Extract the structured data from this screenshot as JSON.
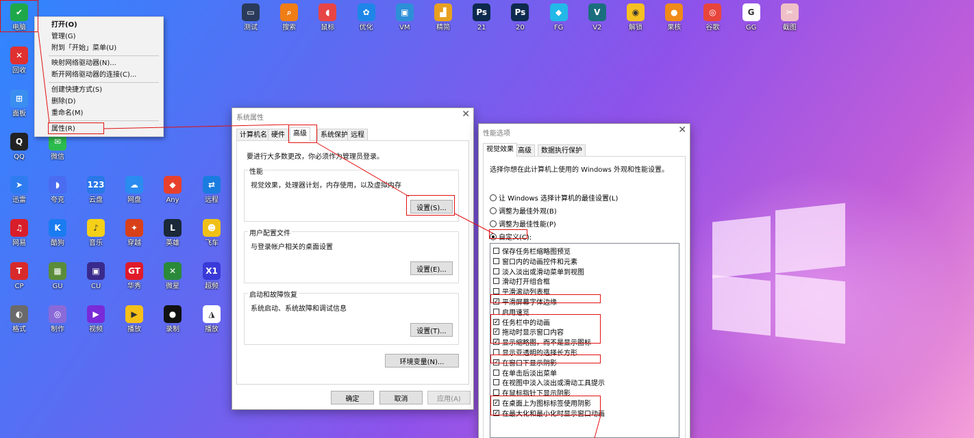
{
  "desktop": {
    "top_icons": [
      {
        "label": "测试",
        "icon": "monitor-icon",
        "color": "#2a3a5a"
      },
      {
        "label": "搜索",
        "icon": "search-icon",
        "color": "#f07d16"
      },
      {
        "label": "鼠标",
        "icon": "mouse-icon",
        "color": "#e84545"
      },
      {
        "label": "优化",
        "icon": "gear-icon",
        "color": "#1e86e8"
      },
      {
        "label": "VM",
        "icon": "vm-icon",
        "color": "#2d8fd8"
      },
      {
        "label": "精简",
        "icon": "chart-icon",
        "color": "#e8a020"
      },
      {
        "label": "21",
        "icon": "photoshop-icon",
        "color": "#0d2a4e"
      },
      {
        "label": "20",
        "icon": "photoshop-icon",
        "color": "#0d2a4e"
      },
      {
        "label": "FG",
        "icon": "fg-icon",
        "color": "#22b8e8"
      },
      {
        "label": "V2",
        "icon": "v2-icon",
        "color": "#1a6e7e"
      },
      {
        "label": "解锁",
        "icon": "unlock-icon",
        "color": "#f5c020"
      },
      {
        "label": "果核",
        "icon": "fruit-icon",
        "color": "#f08a18"
      },
      {
        "label": "谷歌",
        "icon": "chrome-icon",
        "color": "#e8453c"
      },
      {
        "label": "GG",
        "icon": "google-icon",
        "color": "#ffffff"
      },
      {
        "label": "截图",
        "icon": "screenshot-icon",
        "color": "#f0c0c8"
      }
    ],
    "left_icons": [
      {
        "label": "电脑",
        "icon": "shield-check-icon",
        "color": "#1ea84a"
      },
      {
        "label": "回收",
        "icon": "shield-x-icon",
        "color": "#e03030"
      },
      {
        "label": "面板",
        "icon": "windows-tiles-icon",
        "color": "#3a8ef0"
      },
      {
        "label": "QQ",
        "icon": "qq-penguin-icon",
        "color": "#222222"
      },
      {
        "label": "微信",
        "icon": "wechat-icon",
        "color": "#2dbb4e"
      },
      {
        "label": "迅雷",
        "icon": "thunder-icon",
        "color": "#2e7cf0"
      },
      {
        "label": "夸克",
        "icon": "quark-icon",
        "color": "#4a6cf0"
      },
      {
        "label": "云盘",
        "icon": "cloud-123-icon",
        "color": "#2a78e8"
      },
      {
        "label": "网盘",
        "icon": "baidu-pan-icon",
        "color": "#2a8cf0"
      },
      {
        "label": "Any",
        "icon": "anydesk-icon",
        "color": "#e8402c"
      },
      {
        "label": "远程",
        "icon": "remote-icon",
        "color": "#1a7ce0"
      },
      {
        "label": "网易",
        "icon": "netease-music-icon",
        "color": "#d81e2a"
      },
      {
        "label": "酷狗",
        "icon": "kugou-icon",
        "color": "#1a7cf0"
      },
      {
        "label": "音乐",
        "icon": "qqmusic-icon",
        "color": "#f5d018"
      },
      {
        "label": "穿越",
        "icon": "cf-icon",
        "color": "#d8401a"
      },
      {
        "label": "英雄",
        "icon": "lol-icon",
        "color": "#1a2838"
      },
      {
        "label": "飞车",
        "icon": "speed-icon",
        "color": "#f0c018"
      },
      {
        "label": "CP",
        "icon": "cp-icon",
        "color": "#d82a2a"
      },
      {
        "label": "GU",
        "icon": "gpu-icon",
        "color": "#5a8c3a"
      },
      {
        "label": "CU",
        "icon": "cpu-icon",
        "color": "#3a2a8c"
      },
      {
        "label": "华秀",
        "icon": "gt3-icon",
        "color": "#e01a2a"
      },
      {
        "label": "微星",
        "icon": "xbox-icon",
        "color": "#2a8a3a"
      },
      {
        "label": "超频",
        "icon": "x1-icon",
        "color": "#3a3ad8"
      },
      {
        "label": "格式",
        "icon": "format-icon",
        "color": "#6a6a6a"
      },
      {
        "label": "制作",
        "icon": "disc-icon",
        "color": "#8a6ad8"
      },
      {
        "label": "视频",
        "icon": "video-icon",
        "color": "#7a2ad8"
      },
      {
        "label": "播放",
        "icon": "player-icon",
        "color": "#f5c018"
      },
      {
        "label": "录制",
        "icon": "record-icon",
        "color": "#111111"
      },
      {
        "label": "播放",
        "icon": "alien-icon",
        "color": "#ffffff"
      }
    ]
  },
  "context_menu": {
    "items": [
      {
        "label": "打开(O)",
        "bold": true
      },
      {
        "label": "管理(G)"
      },
      {
        "label": "附到「开始」菜单(U)"
      },
      {
        "label": "映射网络驱动器(N)..."
      },
      {
        "label": "断开网络驱动器的连接(C)..."
      },
      {
        "label": "创建快捷方式(S)"
      },
      {
        "label": "删除(D)"
      },
      {
        "label": "重命名(M)"
      },
      {
        "label": "属性(R)"
      }
    ]
  },
  "system_properties": {
    "title": "系统属性",
    "tabs": [
      "计算机名",
      "硬件",
      "高级",
      "系统保护",
      "远程"
    ],
    "active_tab": "高级",
    "admin_note": "要进行大多数更改，你必须作为管理员登录。",
    "performance": {
      "title": "性能",
      "desc": "视觉效果，处理器计划，内存使用，以及虚拟内存",
      "button": "设置(S)..."
    },
    "user_profiles": {
      "title": "用户配置文件",
      "desc": "与登录帐户相关的桌面设置",
      "button": "设置(E)..."
    },
    "startup_recovery": {
      "title": "启动和故障恢复",
      "desc": "系统启动、系统故障和调试信息",
      "button": "设置(T)..."
    },
    "env_button": "环境变量(N)...",
    "ok": "确定",
    "cancel": "取消",
    "apply": "应用(A)"
  },
  "performance_options": {
    "title": "性能选项",
    "tabs": [
      "视觉效果",
      "高级",
      "数据执行保护"
    ],
    "active_tab": "视觉效果",
    "intro": "选择你想在此计算机上使用的 Windows 外观和性能设置。",
    "radios": [
      {
        "label": "让 Windows 选择计算机的最佳设置(L)",
        "selected": false
      },
      {
        "label": "调整为最佳外观(B)",
        "selected": false
      },
      {
        "label": "调整为最佳性能(P)",
        "selected": false
      },
      {
        "label": "自定义(C):",
        "selected": true
      }
    ],
    "options": [
      {
        "label": "保存任务栏缩略图预览",
        "checked": false
      },
      {
        "label": "窗口内的动画控件和元素",
        "checked": false
      },
      {
        "label": "淡入淡出或滑动菜单到视图",
        "checked": false
      },
      {
        "label": "滑动打开组合框",
        "checked": false
      },
      {
        "label": "平滑滚动列表框",
        "checked": false
      },
      {
        "label": "平滑屏幕字体边缘",
        "checked": true
      },
      {
        "label": "启用速览",
        "checked": false
      },
      {
        "label": "任务栏中的动画",
        "checked": true
      },
      {
        "label": "拖动时显示窗口内容",
        "checked": true
      },
      {
        "label": "显示缩略图，而不是显示图标",
        "checked": true
      },
      {
        "label": "显示亚透明的选择长方形",
        "checked": false
      },
      {
        "label": "在窗口下显示阴影",
        "checked": true
      },
      {
        "label": "在单击后淡出菜单",
        "checked": false
      },
      {
        "label": "在视图中淡入淡出或滑动工具提示",
        "checked": false
      },
      {
        "label": "在鼠标指针下显示阴影",
        "checked": false
      },
      {
        "label": "在桌面上为图标标签使用阴影",
        "checked": true
      },
      {
        "label": "在最大化和最小化时显示窗口动画",
        "checked": true
      }
    ]
  }
}
